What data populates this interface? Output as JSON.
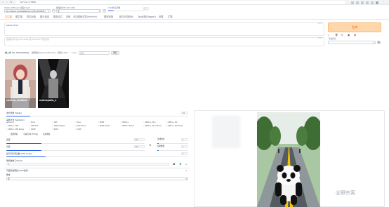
{
  "browser": {
    "url": "127.0.0.1:7860"
  },
  "header": {
    "model_label": "Stable Diffusion 模型(ckpt)",
    "model_value": "sd-xl-base-1.0.safetensors [31e35c80fc]",
    "vae_label": "模型的VAE (SD VAE)",
    "vae_value": "无",
    "clip_label": "CLIP终止层数",
    "clip_value": "2"
  },
  "tabs": [
    "文生图",
    "图生图",
    "附加功能",
    "图片信息",
    "模型合并",
    "训练",
    "无边图像浏览(Infinite)",
    "模型转换",
    "超清分割放大",
    "Tag反推(Tagger)",
    "设置",
    "扩展"
  ],
  "prompt": {
    "positive": "panda, front",
    "negative_placeholder": "反向提示词 (按 Ctrl+Enter 或 Alt+Enter 开始生成)",
    "token_count_pos": "2/75",
    "token_count_neg": "0/75"
  },
  "generate": {
    "label": "生成",
    "style_label": "预设样式"
  },
  "extra_networks": {
    "tabs": [
      "嵌入式 (T.I. Embedding)",
      "超网络(Hypernetworks)",
      "模型(ckpt)",
      "Lora"
    ],
    "search_placeholder": "搜索",
    "refresh_label": "刷新",
    "cards": [
      "corneo_makima",
      "metropolis_v"
    ]
  },
  "settings": {
    "steps_label": "迭代步数 (Steps)",
    "steps_value": "20",
    "sampler_label": "采样方法 (Sampler)",
    "samplers": [
      "Euler a",
      "Euler",
      "LMS",
      "Heun",
      "DPM2",
      "DPM2 a",
      "DPM++ 2S a",
      "DPM++ 2M",
      "DPM++ SDE",
      "DPM fast",
      "DPM adaptive",
      "LMS Karras",
      "DPM2 Karras",
      "DPM2 a Karras",
      "DPM++ 2S a Karras",
      "DPM++ 2M Karras",
      "DPM++ SDE Karras",
      "DDIM",
      "PLMS",
      "UniPC"
    ],
    "sampler_selected": "Euler a",
    "opts": [
      "面部修复",
      "平铺/分块 (Tiling)",
      "高清修复"
    ],
    "width_label": "宽度",
    "width_value": "512",
    "height_label": "高度",
    "height_value": "512",
    "batch_count_label": "生成批次",
    "batch_count_value": "1",
    "batch_size_label": "每批数量",
    "batch_size_value": "1",
    "cfg_label": "提示词引导系数 (CFG Scale)",
    "cfg_value": "7",
    "seed_label": "随机数种子(Seed)",
    "seed_value": "-1",
    "extra_label": "可选附加网络(LoRA插件)",
    "script_label": "脚本",
    "script_value": "无"
  },
  "output": {
    "watermark": "@野宗客"
  }
}
